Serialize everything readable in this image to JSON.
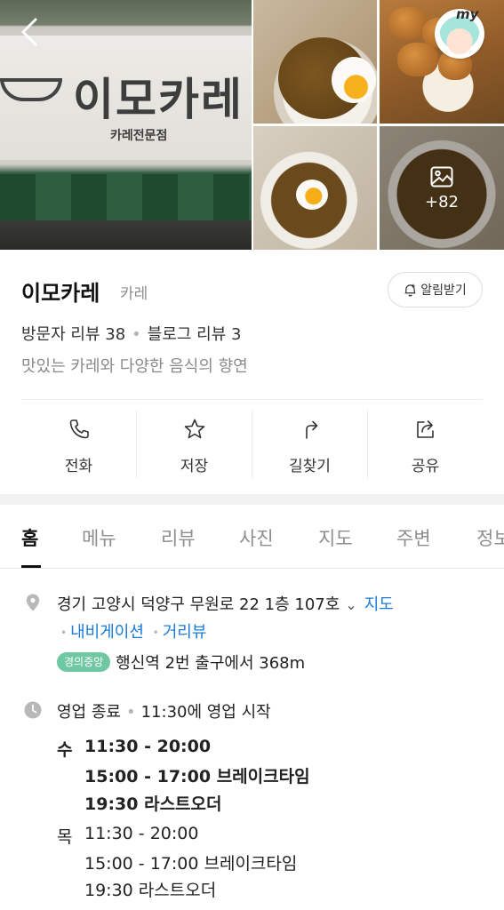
{
  "header": {
    "photo_sign_text": "이모카레",
    "photo_sign_subtext": "카레전문점",
    "my_badge_label": "my",
    "more_photos_count": "+82"
  },
  "place": {
    "name": "이모카레",
    "category": "카레",
    "alarm_button": "알림받기",
    "visitor_reviews": "방문자 리뷰 38",
    "blog_reviews": "블로그 리뷰 3",
    "description": "맛있는 카레와 다양한 음식의 향연"
  },
  "actions": [
    {
      "label": "전화",
      "icon": "phone-icon"
    },
    {
      "label": "저장",
      "icon": "star-icon"
    },
    {
      "label": "길찾기",
      "icon": "directions-icon"
    },
    {
      "label": "공유",
      "icon": "share-icon"
    }
  ],
  "tabs": [
    "홈",
    "메뉴",
    "리뷰",
    "사진",
    "지도",
    "주변",
    "정보"
  ],
  "active_tab": "홈",
  "location": {
    "address": "경기 고양시 덕양구 무원로 22 1층 107호",
    "map_link": "지도",
    "navigation_link": "내비게이션",
    "roadview_link": "거리뷰",
    "subway_line": "경의중앙",
    "subway_text": "행신역 2번 출구에서 368m"
  },
  "hours": {
    "status": "영업 종료",
    "next_open": "11:30에 영업 시작",
    "days": [
      {
        "day": "수",
        "hours": "11:30 - 20:00",
        "break": "15:00 - 17:00 브레이크타임",
        "last_order": "19:30 라스트오더",
        "highlight": true
      },
      {
        "day": "목",
        "hours": "11:30 - 20:00",
        "break": "15:00 - 17:00 브레이크타임",
        "last_order": "19:30 라스트오더",
        "highlight": false
      }
    ]
  },
  "colors": {
    "link": "#1a7bd8",
    "line_badge": "#6fc7a3",
    "muted_text": "#8e8e8e"
  }
}
